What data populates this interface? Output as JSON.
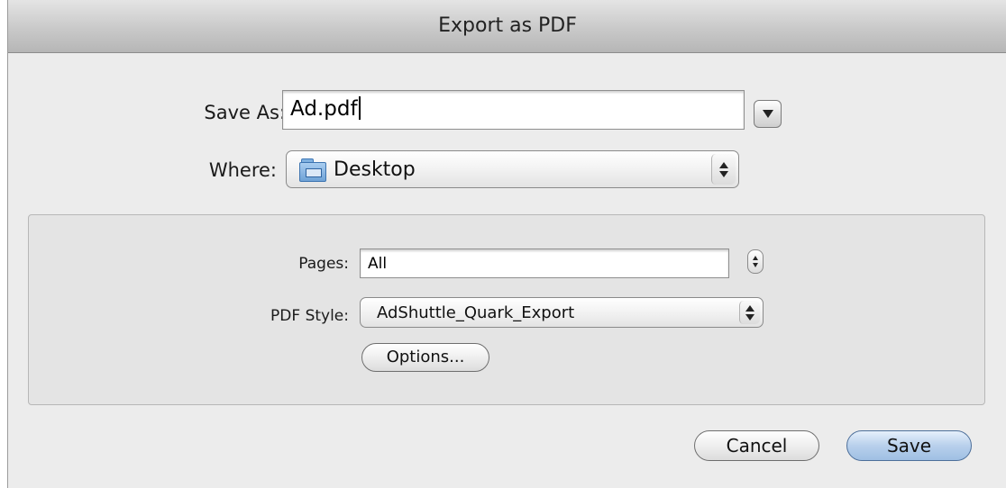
{
  "dialog": {
    "title": "Export as PDF"
  },
  "save_as": {
    "label": "Save As:",
    "value": "Ad.pdf"
  },
  "where": {
    "label": "Where:",
    "value": "Desktop",
    "icon": "folder-icon"
  },
  "pages": {
    "label": "Pages:",
    "value": "All"
  },
  "pdf_style": {
    "label": "PDF Style:",
    "value": "AdShuttle_Quark_Export"
  },
  "buttons": {
    "options": "Options...",
    "cancel": "Cancel",
    "save": "Save"
  },
  "colors": {
    "dialog_bg": "#ececec",
    "default_button": "#b8d0ec"
  }
}
